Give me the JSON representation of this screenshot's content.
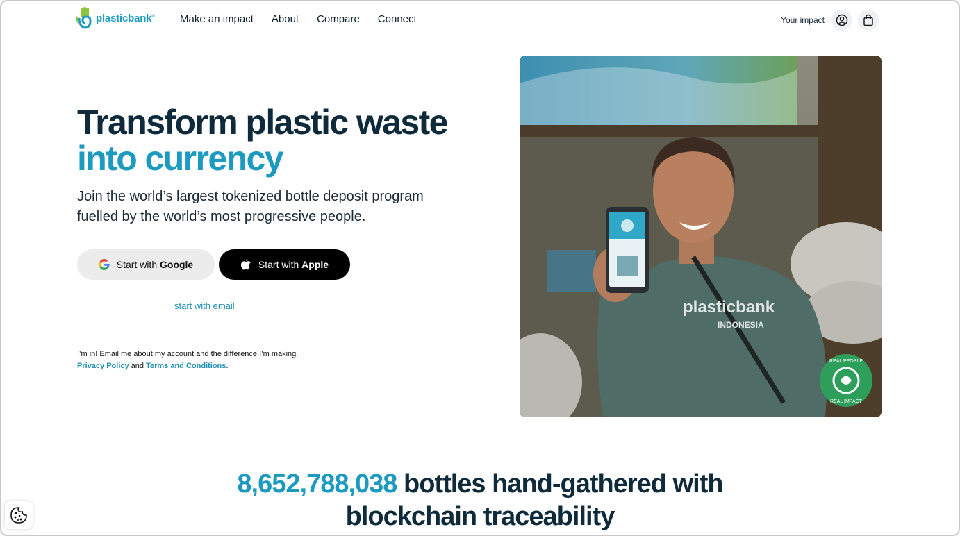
{
  "nav": {
    "logo_text": "plasticbank",
    "logo_reg": "®",
    "menu": [
      "Make an impact",
      "About",
      "Compare",
      "Connect"
    ],
    "your_impact": "Your impact"
  },
  "hero": {
    "title_line1": "Transform plastic waste",
    "title_line2": "into currency",
    "subtitle": "Join the world’s largest tokenized bottle deposit program fuelled by the world’s most progressive people.",
    "google_prefix": "Start with",
    "google_bold": "Google",
    "apple_prefix": "Start with",
    "apple_bold": "Apple",
    "email_link": "start with email",
    "consent_text": "I’m in! Email me about my account and the difference I’m making.",
    "privacy_link": "Privacy Policy",
    "and": "and",
    "terms_link": "Terms and Conditions",
    "period": "."
  },
  "image": {
    "shirt_brand": "plasticbank",
    "shirt_region": "INDONESIA",
    "badge_top": "REAL PEOPLE",
    "badge_bottom": "REAL IMPACT"
  },
  "stats": {
    "count": "8,652,788,038",
    "text_line1": "bottles hand-gathered with",
    "text_line2": "blockchain traceability"
  },
  "colors": {
    "accent": "#1d9ac0",
    "dark": "#0e2a3b",
    "badge_green": "#2e9e5b"
  }
}
